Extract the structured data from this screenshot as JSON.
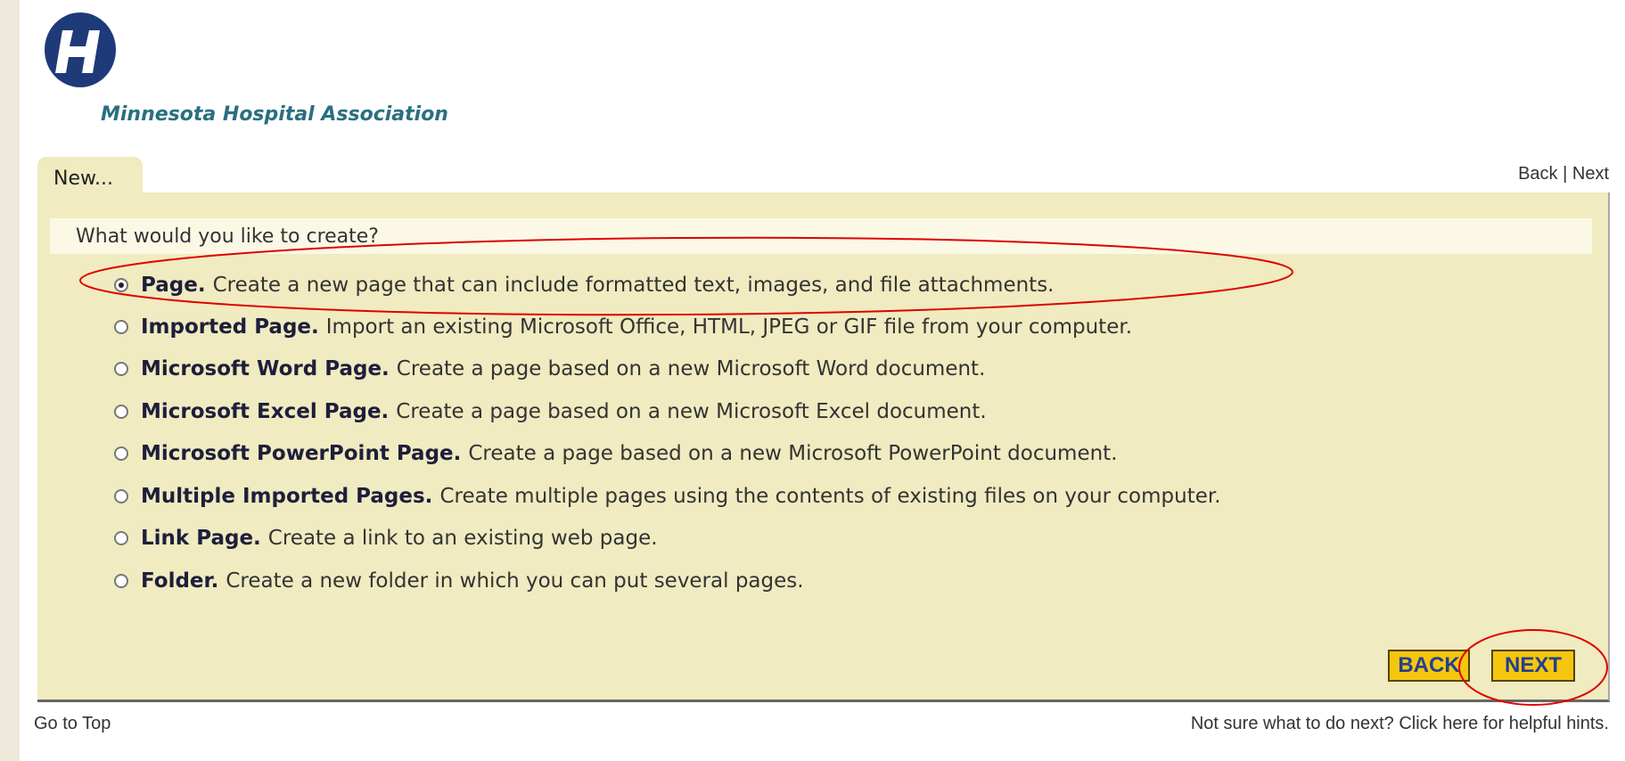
{
  "header": {
    "logo_text": "Minnesota Hospital Association",
    "logo_letter": "H"
  },
  "tab": {
    "label": "New..."
  },
  "top_nav": {
    "back": "Back",
    "separator": "|",
    "next": "Next"
  },
  "form": {
    "question": "What would you like to create?",
    "options": [
      {
        "title": "Page.",
        "desc": "Create a new page that can include formatted text, images, and file attachments.",
        "selected": true
      },
      {
        "title": "Imported Page.",
        "desc": "Import an existing Microsoft Office, HTML, JPEG or GIF file from your computer.",
        "selected": false
      },
      {
        "title": "Microsoft Word Page.",
        "desc": "Create a page based on a new Microsoft Word document.",
        "selected": false
      },
      {
        "title": "Microsoft Excel Page.",
        "desc": "Create a page based on a new Microsoft Excel document.",
        "selected": false
      },
      {
        "title": "Microsoft PowerPoint Page.",
        "desc": "Create a page based on a new Microsoft PowerPoint document.",
        "selected": false
      },
      {
        "title": "Multiple Imported Pages.",
        "desc": "Create multiple pages using the contents of existing files on your computer.",
        "selected": false
      },
      {
        "title": "Link Page.",
        "desc": "Create a link to an existing web page.",
        "selected": false
      },
      {
        "title": "Folder.",
        "desc": "Create a new folder in which you can put several pages.",
        "selected": false
      }
    ]
  },
  "buttons": {
    "back": "BACK",
    "next": "NEXT"
  },
  "footer": {
    "go_to_top": "Go to Top",
    "hints": "Not sure what to do next? Click here for helpful hints."
  },
  "colors": {
    "panel": "#f0ebc0",
    "button": "#f5c60f",
    "button_text": "#233f8f",
    "logo": "#1e3a78",
    "annotation": "#e00000"
  }
}
